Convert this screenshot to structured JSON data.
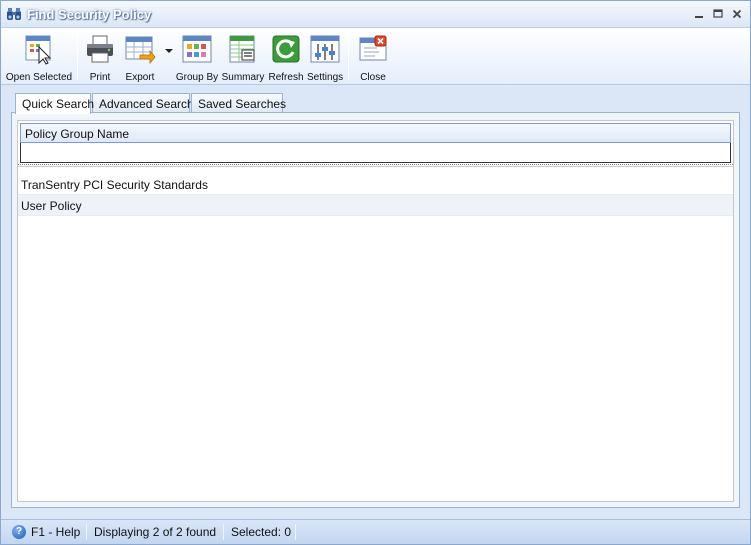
{
  "window": {
    "title": "Find Security Policy",
    "icon": "binoculars-icon",
    "controls": [
      "minimize",
      "maximize",
      "close"
    ]
  },
  "toolbar": {
    "buttons": [
      {
        "label": "Open Selected",
        "icon": "open-selected-icon"
      },
      {
        "label": "Print",
        "icon": "printer-icon"
      },
      {
        "label": "Export",
        "icon": "export-icon",
        "has_dropdown": true
      },
      {
        "label": "Group By",
        "icon": "group-by-icon"
      },
      {
        "label": "Summary",
        "icon": "summary-icon"
      },
      {
        "label": "Refresh",
        "icon": "refresh-icon"
      },
      {
        "label": "Settings",
        "icon": "settings-icon"
      },
      {
        "label": "Close",
        "icon": "close-window-icon"
      }
    ]
  },
  "tabs": [
    {
      "label": "Quick Search",
      "active": true
    },
    {
      "label": "Advanced Search",
      "active": false
    },
    {
      "label": "Saved Searches",
      "active": false
    }
  ],
  "grid": {
    "columns": [
      "Policy Group Name"
    ],
    "filter_value": "",
    "rows": [
      {
        "name": "TranSentry PCI Security Standards"
      },
      {
        "name": "User Policy"
      }
    ]
  },
  "status": {
    "help": "F1 - Help",
    "display": "Displaying 2 of 2 found",
    "selected": "Selected: 0",
    "help_icon": "help-icon"
  },
  "colors": {
    "frame": "#dbe7f7",
    "border": "#8aa7cf",
    "alt_row": "#eef3fa"
  }
}
